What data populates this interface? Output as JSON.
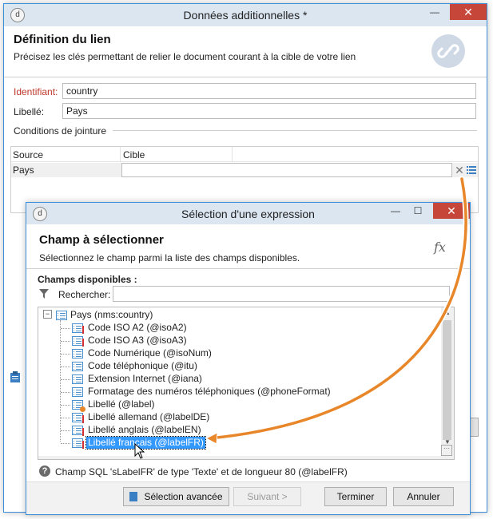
{
  "outer": {
    "title": "Données additionnelles *",
    "header_title": "Définition du lien",
    "header_subtitle": "Précisez les clés permettant de relier le document courant à la cible de votre lien",
    "id_label": "Identifiant:",
    "id_value": "country",
    "label_label": "Libellé:",
    "label_value": "Pays",
    "join_section": "Conditions de jointure",
    "col_source": "Source",
    "col_target": "Cible",
    "row_source": "Pays",
    "row_target": "",
    "link_icon": "link-icon",
    "close_glyph": "✕",
    "minimize_glyph": "—"
  },
  "inner": {
    "title": "Sélection d'une expression",
    "header_title": "Champ à sélectionner",
    "header_subtitle": "Sélectionnez le champ parmi la liste des champs disponibles.",
    "fx": "fx",
    "available_label": "Champs disponibles :",
    "search_label": "Rechercher:",
    "search_value": "",
    "tree_root": "Pays (nms:country)",
    "tree_items": [
      {
        "label": "Code ISO A2 (@isoA2)",
        "mark": true,
        "selected": false
      },
      {
        "label": "Code ISO A3 (@isoA3)",
        "mark": true,
        "selected": false
      },
      {
        "label": "Code Numérique (@isoNum)",
        "mark": false,
        "selected": false
      },
      {
        "label": "Code téléphonique (@itu)",
        "mark": false,
        "selected": false
      },
      {
        "label": "Extension Internet (@iana)",
        "mark": false,
        "selected": false
      },
      {
        "label": "Formatage des numéros téléphoniques (@phoneFormat)",
        "mark": false,
        "selected": false
      },
      {
        "label": "Libellé (@label)",
        "mark": false,
        "special": true,
        "selected": false
      },
      {
        "label": "Libellé allemand (@labelDE)",
        "mark": true,
        "selected": false
      },
      {
        "label": "Libellé anglais (@labelEN)",
        "mark": true,
        "selected": false
      },
      {
        "label": "Libellé français (@labelFR)",
        "mark": true,
        "selected": true
      }
    ],
    "status": "Champ SQL 'sLabelFR' de type 'Texte' et de longueur 80 (@labelFR)",
    "btn_advanced": "Sélection avancée",
    "btn_next": "Suivant >",
    "btn_finish": "Terminer",
    "btn_cancel": "Annuler",
    "close_glyph": "✕",
    "minimize_glyph": "—",
    "maximize_glyph": "☐"
  },
  "colors": {
    "accent_orange": "#e8862a",
    "selection": "#3399ff",
    "required_red": "#c0392b",
    "close_red": "#c7463a"
  }
}
